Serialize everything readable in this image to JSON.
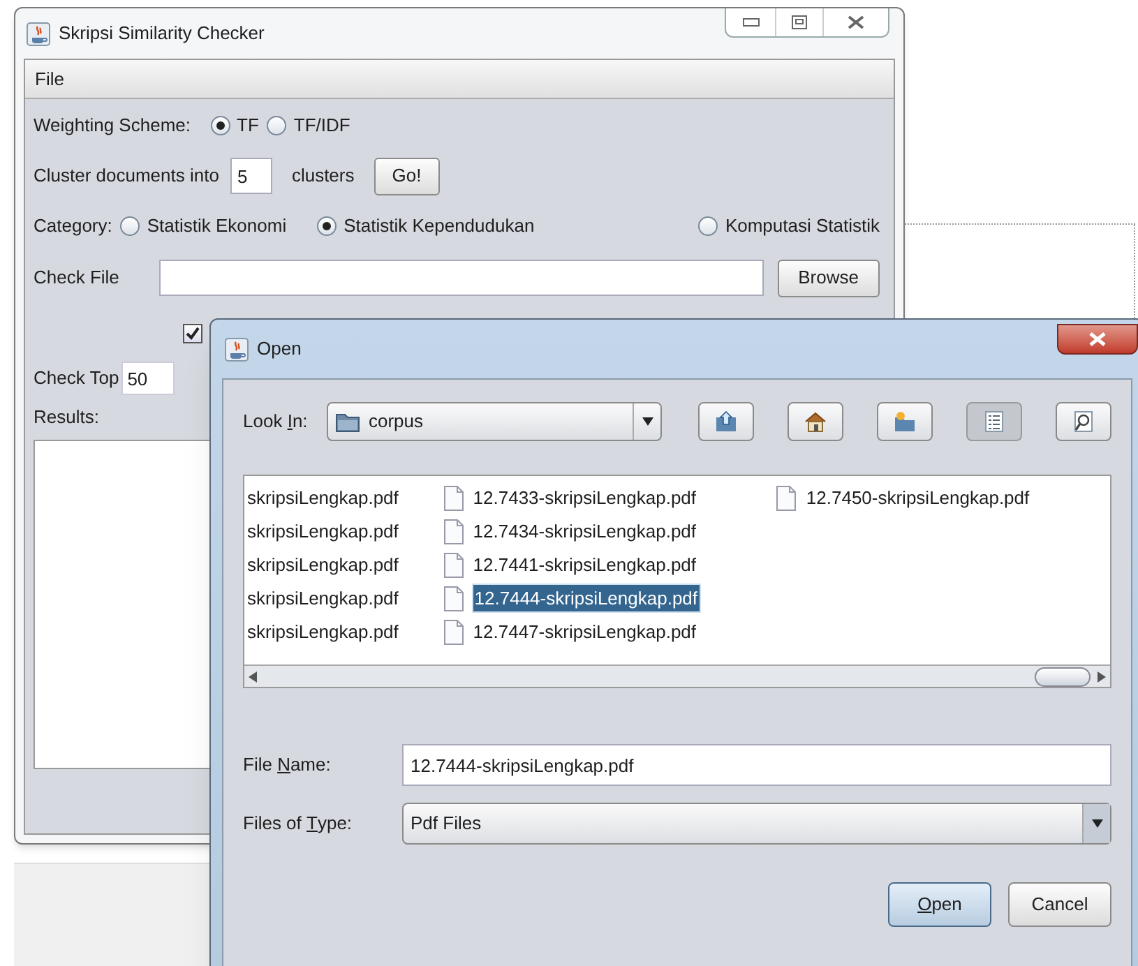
{
  "main_window": {
    "title": "Skripsi Similarity Checker",
    "menu": [
      "File"
    ],
    "weighting": {
      "label": "Weighting Scheme:",
      "options": [
        {
          "label": "TF",
          "selected": true
        },
        {
          "label": "TF/IDF",
          "selected": false
        }
      ]
    },
    "cluster": {
      "label": "Cluster documents into",
      "value": "5",
      "suffix": "clusters",
      "button": "Go!"
    },
    "category": {
      "label": "Category:",
      "options": [
        {
          "label": "Statistik Ekonomi",
          "selected": false
        },
        {
          "label": "Statistik Kependudukan",
          "selected": true
        },
        {
          "label": "Komputasi Statistik",
          "selected": false
        }
      ]
    },
    "check_file": {
      "label": "Check File",
      "button": "Browse"
    },
    "checkbox": {
      "checked": true
    },
    "check_top": {
      "label": "Check Top",
      "value": "50"
    },
    "results": {
      "label": "Results:"
    }
  },
  "open_dialog": {
    "title": "Open",
    "look_in": {
      "label": [
        {
          "text": "Look ",
          "underlined": false
        },
        {
          "text": "I",
          "underlined": true
        },
        {
          "text": "n:",
          "underlined": false
        }
      ],
      "value": "corpus"
    },
    "toolbar": [
      {
        "kind": "up",
        "selected": false
      },
      {
        "kind": "home",
        "selected": false
      },
      {
        "kind": "new_folder",
        "selected": false
      },
      {
        "kind": "list",
        "selected": true
      },
      {
        "kind": "details",
        "selected": false
      }
    ],
    "file_columns": [
      {
        "icons": false,
        "items": [
          {
            "name": "skripsiLengkap.pdf",
            "selected": false
          },
          {
            "name": "skripsiLengkap.pdf",
            "selected": false
          },
          {
            "name": "skripsiLengkap.pdf",
            "selected": false
          },
          {
            "name": "skripsiLengkap.pdf",
            "selected": false
          },
          {
            "name": "skripsiLengkap.pdf",
            "selected": false
          }
        ]
      },
      {
        "icons": true,
        "items": [
          {
            "name": "12.7433-skripsiLengkap.pdf",
            "selected": false
          },
          {
            "name": "12.7434-skripsiLengkap.pdf",
            "selected": false
          },
          {
            "name": "12.7441-skripsiLengkap.pdf",
            "selected": false
          },
          {
            "name": "12.7444-skripsiLengkap.pdf",
            "selected": true
          },
          {
            "name": "12.7447-skripsiLengkap.pdf",
            "selected": false
          }
        ]
      },
      {
        "icons": true,
        "items": [
          {
            "name": "12.7450-skripsiLengkap.pdf",
            "selected": false
          }
        ]
      }
    ],
    "file_name": {
      "label": [
        {
          "text": "File ",
          "underlined": false
        },
        {
          "text": "N",
          "underlined": true
        },
        {
          "text": "ame:",
          "underlined": false
        }
      ],
      "value": "12.7444-skripsiLengkap.pdf"
    },
    "file_type": {
      "label": [
        {
          "text": "Files of ",
          "underlined": false
        },
        {
          "text": "T",
          "underlined": true
        },
        {
          "text": "ype:",
          "underlined": false
        }
      ],
      "value": "Pdf Files"
    },
    "buttons": [
      {
        "label": [
          {
            "text": "O",
            "underlined": true
          },
          {
            "text": "pen",
            "underlined": false
          }
        ],
        "default": true
      },
      {
        "label": [
          {
            "text": "Cancel",
            "underlined": false
          }
        ],
        "default": false
      }
    ]
  }
}
